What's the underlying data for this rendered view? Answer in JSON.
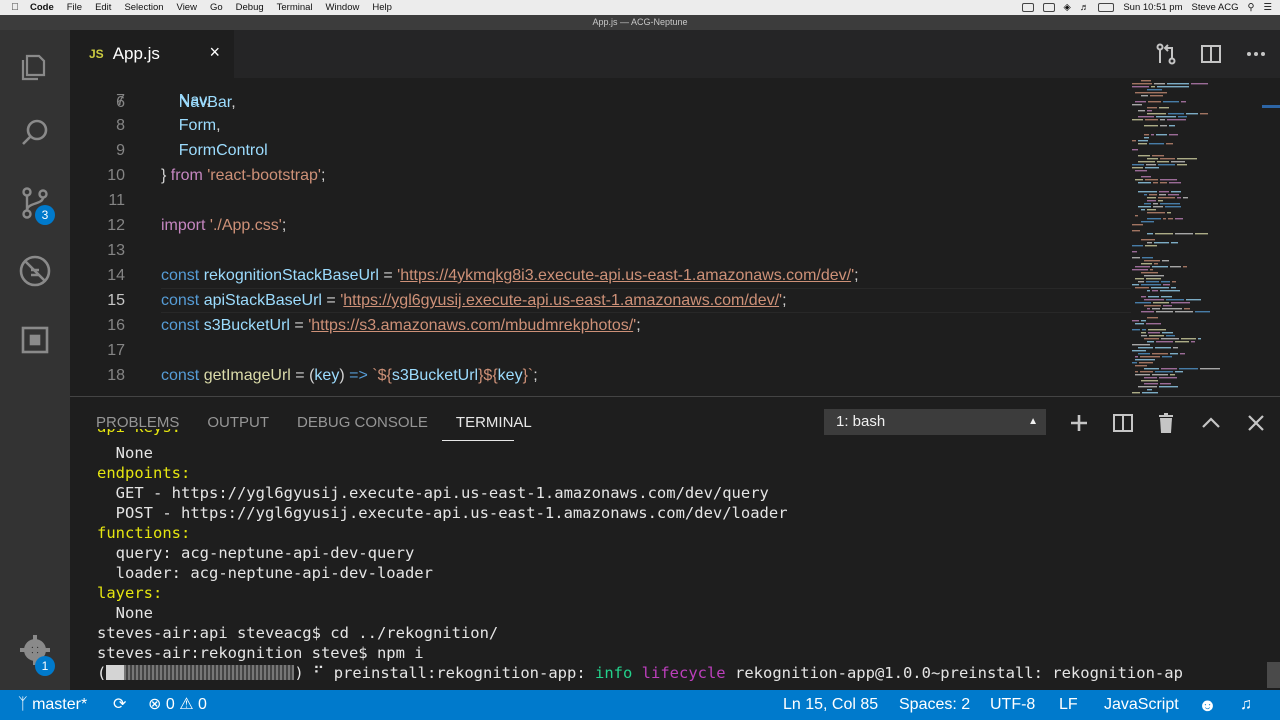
{
  "menubar": {
    "app": "Code",
    "items": [
      "File",
      "Edit",
      "Selection",
      "View",
      "Go",
      "Debug",
      "Terminal",
      "Window",
      "Help"
    ],
    "clock": "Sun 10:51 pm",
    "user": "Steve ACG"
  },
  "window": {
    "title": "App.js — ACG-Neptune"
  },
  "activity": {
    "scm_badge": "3",
    "settings_badge": "1"
  },
  "tab": {
    "icon_label": "JS",
    "name": "App.js",
    "close": "×"
  },
  "editor": {
    "active_line": "15",
    "lines": [
      {
        "n": "7",
        "parts": [
          [
            "    ",
            ""
          ],
          [
            "Nav",
            "var"
          ],
          [
            ",",
            ""
          ]
        ]
      },
      {
        "n": "8",
        "parts": [
          [
            "    ",
            ""
          ],
          [
            "Form",
            "var"
          ],
          [
            ",",
            ""
          ]
        ]
      },
      {
        "n": "9",
        "parts": [
          [
            "    ",
            ""
          ],
          [
            "FormControl",
            "var"
          ]
        ]
      },
      {
        "n": "10",
        "parts": [
          [
            "} ",
            ""
          ],
          [
            "from",
            "kw"
          ],
          [
            " ",
            ""
          ],
          [
            "'react-bootstrap'",
            "str"
          ],
          [
            ";",
            ""
          ]
        ]
      },
      {
        "n": "11",
        "parts": []
      },
      {
        "n": "12",
        "parts": [
          [
            "import",
            "kw"
          ],
          [
            " ",
            ""
          ],
          [
            "'./App.css'",
            "str"
          ],
          [
            ";",
            ""
          ]
        ]
      },
      {
        "n": "13",
        "parts": []
      },
      {
        "n": "14",
        "parts": [
          [
            "const",
            "dec"
          ],
          [
            " ",
            ""
          ],
          [
            "rekognitionStackBaseUrl",
            "var"
          ],
          [
            " = ",
            ""
          ],
          [
            "'",
            "str"
          ],
          [
            "https://4ykmqkg8i3.execute-api.us-east-1.amazonaws.com/dev/",
            "url"
          ],
          [
            "'",
            "str"
          ],
          [
            ";",
            ""
          ]
        ]
      },
      {
        "n": "15",
        "parts": [
          [
            "const",
            "dec"
          ],
          [
            " ",
            ""
          ],
          [
            "apiStackBaseUrl",
            "var"
          ],
          [
            " = ",
            ""
          ],
          [
            "'",
            "str"
          ],
          [
            "https://ygl6gyusij.execute-api.us-east-1.amazonaws.com/dev/",
            "url"
          ],
          [
            "'",
            "str"
          ],
          [
            ";",
            ""
          ]
        ]
      },
      {
        "n": "16",
        "parts": [
          [
            "const",
            "dec"
          ],
          [
            " ",
            ""
          ],
          [
            "s3BucketUrl",
            "var"
          ],
          [
            " = ",
            ""
          ],
          [
            "'",
            "str"
          ],
          [
            "https://s3.amazonaws.com/mbudmrekphotos/",
            "url"
          ],
          [
            "'",
            "str"
          ],
          [
            ";",
            ""
          ]
        ]
      },
      {
        "n": "17",
        "parts": []
      },
      {
        "n": "18",
        "parts": [
          [
            "const",
            "dec"
          ],
          [
            " ",
            ""
          ],
          [
            "getImageUrl",
            "fn"
          ],
          [
            " = (",
            ""
          ],
          [
            "key",
            "var"
          ],
          [
            ") ",
            ""
          ],
          [
            "=>",
            "dec"
          ],
          [
            " ",
            ""
          ],
          [
            "`${",
            "str"
          ],
          [
            "s3BucketUrl",
            "var"
          ],
          [
            "}${",
            "str"
          ],
          [
            "key",
            "var"
          ],
          [
            "}`",
            "str"
          ],
          [
            ";",
            ""
          ]
        ]
      }
    ]
  },
  "panel": {
    "tabs": [
      "PROBLEMS",
      "OUTPUT",
      "DEBUG CONSOLE",
      "TERMINAL"
    ],
    "active_tab": "TERMINAL",
    "shell_select": "1: bash",
    "terminal": [
      [
        [
          "  None",
          ""
        ]
      ],
      [
        [
          "endpoints:",
          "ty"
        ]
      ],
      [
        [
          "  GET - https://ygl6gyusij.execute-api.us-east-1.amazonaws.com/dev/query",
          ""
        ]
      ],
      [
        [
          "  POST - https://ygl6gyusij.execute-api.us-east-1.amazonaws.com/dev/loader",
          ""
        ]
      ],
      [
        [
          "functions:",
          "ty"
        ]
      ],
      [
        [
          "  query: acg-neptune-api-dev-query",
          ""
        ]
      ],
      [
        [
          "  loader: acg-neptune-api-dev-loader",
          ""
        ]
      ],
      [
        [
          "layers:",
          "ty"
        ]
      ],
      [
        [
          "  None",
          ""
        ]
      ],
      [
        [
          "steves-air:api steveacg$ cd ../rekognition/",
          ""
        ]
      ],
      [
        [
          "steves-air:rekognition steve$ npm i",
          ""
        ]
      ]
    ],
    "progress_line": {
      "open": "(",
      "close": ") ⠋ preinstall:rekognition-app: ",
      "info": "info",
      "lifecycle": "lifecycle",
      "rest": " rekognition-app@1.0.0~preinstall: rekognition-ap"
    }
  },
  "status": {
    "branch": "master*",
    "errors": "0",
    "warnings": "0",
    "position": "Ln 15, Col 85",
    "spaces": "Spaces: 2",
    "encoding": "UTF-8",
    "eol": "LF",
    "language": "JavaScript"
  },
  "colors": {
    "accent": "#007acc",
    "activity_bar": "#333333",
    "editor_bg": "#1e1e1e"
  }
}
